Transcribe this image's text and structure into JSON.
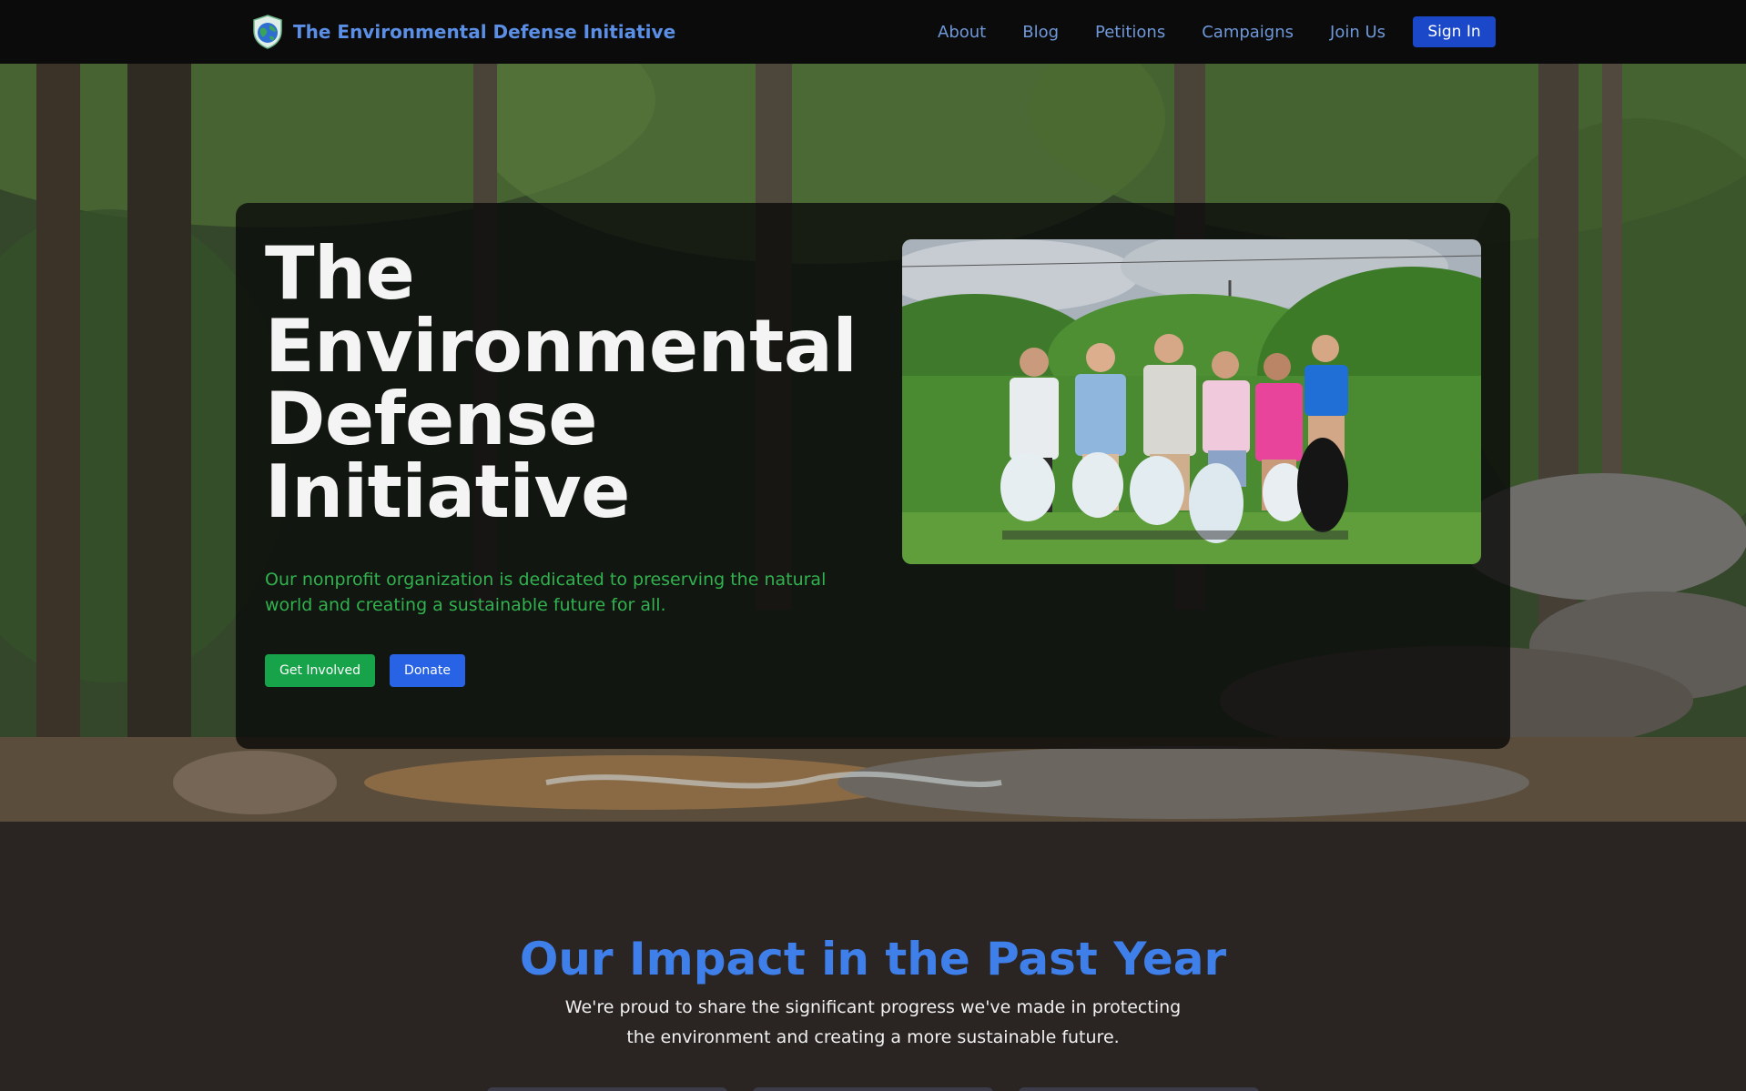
{
  "nav": {
    "brand": "The Environmental Defense Initiative",
    "links": [
      "About",
      "Blog",
      "Petitions",
      "Campaigns",
      "Join Us"
    ],
    "signin": "Sign In"
  },
  "hero": {
    "title": "The Environmental Defense Initiative",
    "subtitle": "Our nonprofit organization is dedicated to preserving the natural world and creating a sustainable future for all.",
    "get_involved": "Get Involved",
    "donate": "Donate"
  },
  "impact": {
    "title": "Our Impact in the Past Year",
    "subtitle": "We're proud to share the significant progress we've made in protecting the environment and creating a more sustainable future."
  },
  "colors": {
    "brand": "#5b8fe6",
    "nav_link": "#6f98d9",
    "signin": "#1a48c9",
    "get_involved": "#17a34a",
    "donate": "#2862e5",
    "hero_subtitle": "#31b24f",
    "impact_title": "#3f7fea"
  },
  "icons": {
    "logo": "shield-globe-icon"
  }
}
